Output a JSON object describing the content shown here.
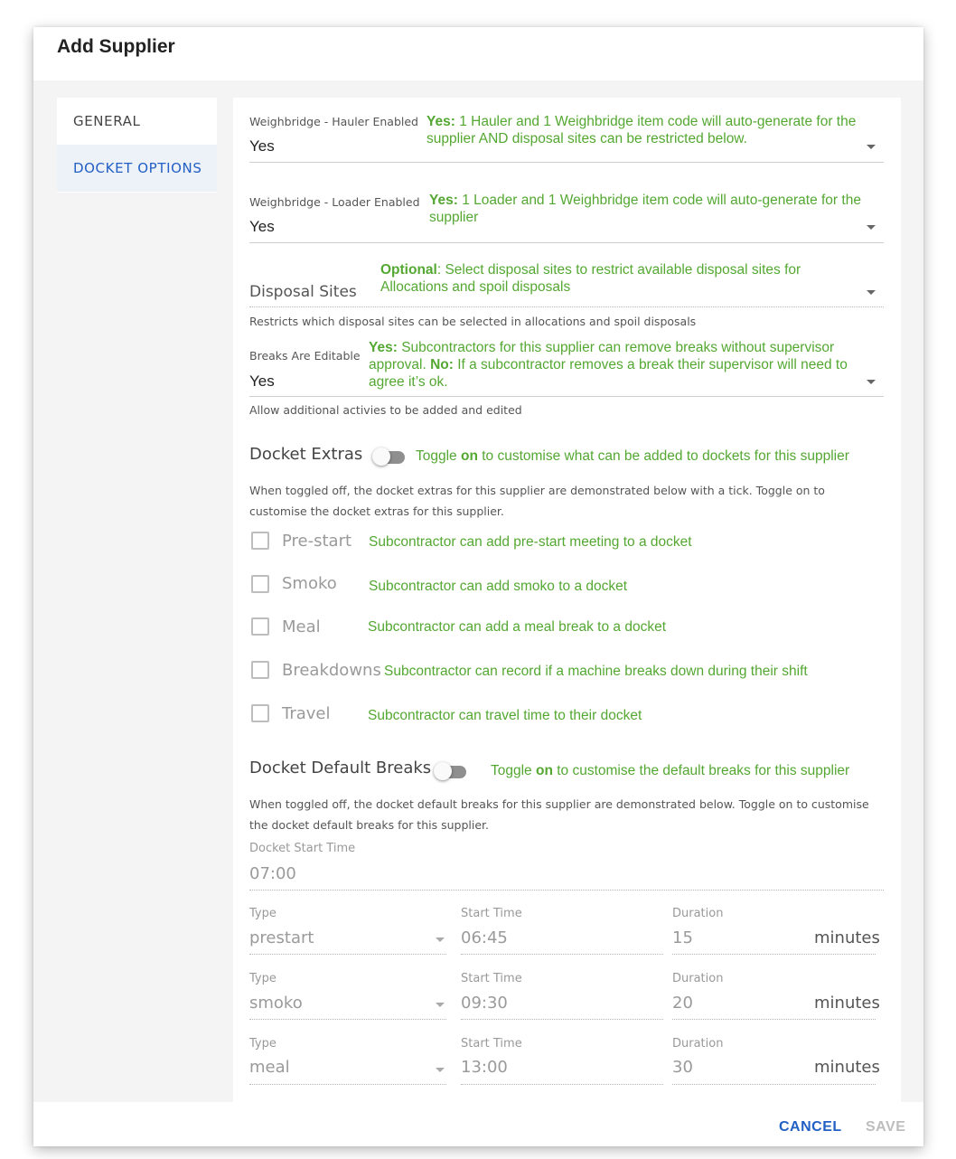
{
  "dialog": {
    "title": "Add Supplier",
    "cancel_label": "CANCEL",
    "save_label": "SAVE"
  },
  "sidenav": {
    "items": [
      {
        "label": "GENERAL",
        "active": false
      },
      {
        "label": "DOCKET OPTIONS",
        "active": true
      }
    ]
  },
  "hauler": {
    "label": "Weighbridge - Hauler Enabled",
    "value": "Yes",
    "note_bold": "Yes:",
    "note_text": " 1 Hauler and 1 Weighbridge item code will auto-generate for the supplier AND disposal sites can be restricted below."
  },
  "loader": {
    "label": "Weighbridge - Loader Enabled",
    "value": "Yes",
    "note_bold": "Yes:",
    "note_text": " 1 Loader and 1 Weighbridge item code will auto-generate for the supplier"
  },
  "disposal": {
    "placeholder": "Disposal Sites",
    "note_bold": "Optional",
    "note_text": ": Select disposal sites to restrict available disposal sites for Allocations and spoil disposals",
    "hint": "Restricts which disposal sites can be selected in allocations and spoil disposals"
  },
  "breaks_editable": {
    "label": "Breaks Are Editable",
    "value": "Yes",
    "note_bold1": "Yes:",
    "note_text1": " Subcontractors for this supplier can remove breaks without supervisor approval. ",
    "note_bold2": "No:",
    "note_text2": " If a subcontractor removes a break their supervisor will need to agree it’s ok.",
    "hint": "Allow additional activies to be added and edited"
  },
  "docket_extras": {
    "title": "Docket Extras",
    "toggle_note_pre": "Toggle ",
    "toggle_note_bold": "on",
    "toggle_note_post": " to customise what can be added to dockets for this supplier",
    "description": "When toggled off, the docket extras for this supplier are demonstrated below with a tick. Toggle on to customise the docket extras for this supplier.",
    "items": [
      {
        "label": "Pre-start",
        "note": "Subcontractor can add pre-start meeting to a docket"
      },
      {
        "label": "Smoko",
        "note": "Subcontractor can add smoko to a docket"
      },
      {
        "label": "Meal",
        "note": "Subcontractor can add a meal break to a docket"
      },
      {
        "label": "Breakdowns",
        "note": "Subcontractor can record if a machine breaks down during their shift"
      },
      {
        "label": "Travel",
        "note": "Subcontractor can travel time to their docket"
      }
    ]
  },
  "default_breaks": {
    "title": "Docket Default Breaks",
    "toggle_note_pre": "Toggle ",
    "toggle_note_bold": "on",
    "toggle_note_post": " to customise the default breaks for this supplier",
    "description": "When toggled off, the docket default breaks for this supplier are demonstrated below. Toggle on to customise the docket default breaks for this supplier.",
    "start_time_label": "Docket Start Time",
    "start_time_value": "07:00",
    "type_label": "Type",
    "start_label": "Start Time",
    "duration_label": "Duration",
    "unit": "minutes",
    "rows": [
      {
        "type": "prestart",
        "start": "06:45",
        "duration": "15"
      },
      {
        "type": "smoko",
        "start": "09:30",
        "duration": "20"
      },
      {
        "type": "meal",
        "start": "13:00",
        "duration": "30"
      }
    ]
  }
}
